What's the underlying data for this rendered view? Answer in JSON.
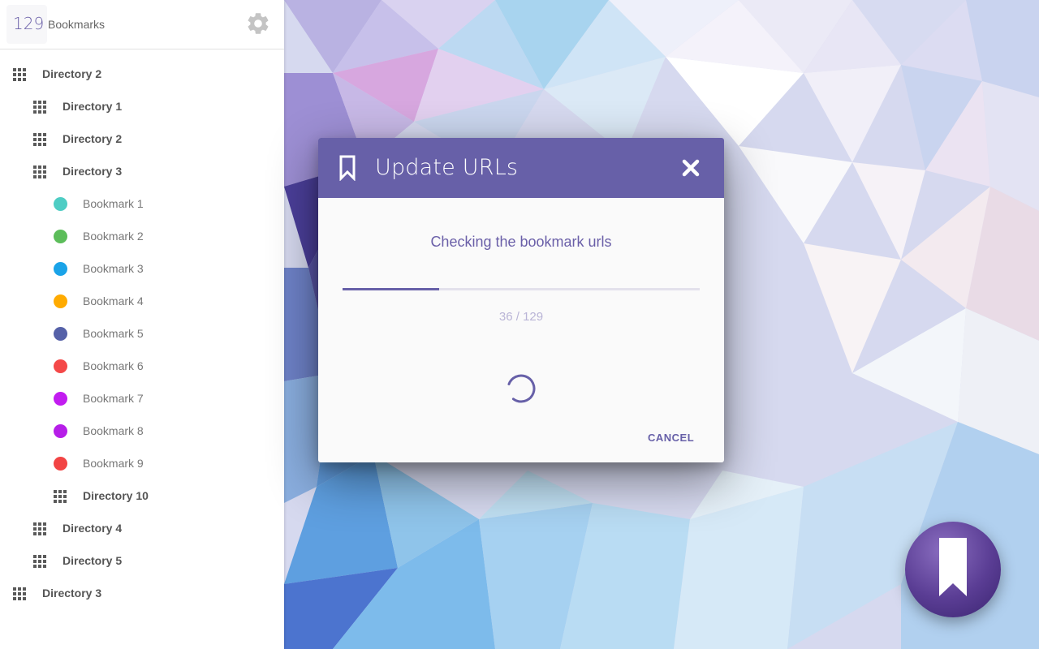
{
  "header": {
    "count": "129",
    "count_label": "Bookmarks"
  },
  "tree": [
    {
      "type": "dir",
      "level": 0,
      "label": "Directory 2"
    },
    {
      "type": "dir",
      "level": 1,
      "label": "Directory 1"
    },
    {
      "type": "dir",
      "level": 1,
      "label": "Directory 2"
    },
    {
      "type": "dir",
      "level": 1,
      "label": "Directory 3"
    },
    {
      "type": "bm",
      "level": 2,
      "label": "Bookmark 1",
      "color": "#4ecdc4"
    },
    {
      "type": "bm",
      "level": 2,
      "label": "Bookmark 2",
      "color": "#5cbd5a"
    },
    {
      "type": "bm",
      "level": 2,
      "label": "Bookmark 3",
      "color": "#1aa3e8"
    },
    {
      "type": "bm",
      "level": 2,
      "label": "Bookmark 4",
      "color": "#ffab00"
    },
    {
      "type": "bm",
      "level": 2,
      "label": "Bookmark 5",
      "color": "#5561a8"
    },
    {
      "type": "bm",
      "level": 2,
      "label": "Bookmark 6",
      "color": "#f44848"
    },
    {
      "type": "bm",
      "level": 2,
      "label": "Bookmark 7",
      "color": "#c21cf0"
    },
    {
      "type": "bm",
      "level": 2,
      "label": "Bookmark 8",
      "color": "#b61ee8"
    },
    {
      "type": "bm",
      "level": 2,
      "label": "Bookmark 9",
      "color": "#f24444"
    },
    {
      "type": "dir",
      "level": 2,
      "label": "Directory 10"
    },
    {
      "type": "dir",
      "level": 1,
      "label": "Directory 4"
    },
    {
      "type": "dir",
      "level": 1,
      "label": "Directory 5"
    },
    {
      "type": "dir",
      "level": 0,
      "label": "Directory 3"
    }
  ],
  "dialog": {
    "title": "Update URLs",
    "message": "Checking the bookmark urls",
    "progress_text": "36 / 129",
    "progress_fraction": 0.27,
    "cancel_label": "CANCEL",
    "header_color": "#6760a8"
  },
  "icons": {
    "settings": "gear-icon",
    "dialog": "bookmark-outline-icon",
    "close": "close-icon",
    "fab": "bookmark-icon",
    "directory": "grid-icon"
  }
}
